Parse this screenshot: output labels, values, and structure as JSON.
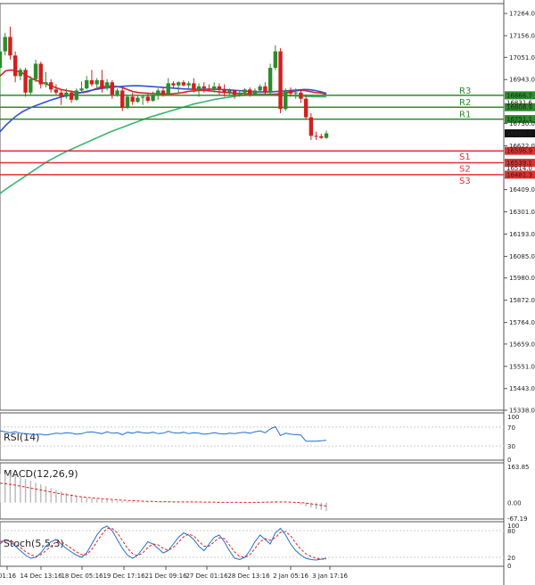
{
  "chart_data": [
    {
      "type": "candlestick",
      "price_axis_ticks": [
        "17264.0",
        "17156.0",
        "17051.0",
        "16943.0",
        "16730.0",
        "16622.0",
        "16409.0",
        "16301.0",
        "16193.0",
        "16085.0",
        "15980.0",
        "15872.0",
        "15764.0",
        "15659.0",
        "15551.0",
        "15443.0",
        "15338.0"
      ],
      "ylim": [
        15338,
        17312
      ],
      "x_tick_labels": [
        "01:16",
        "14 Dec 13:16",
        "18 Dec 05:16",
        "19 Dec 17:16",
        "21 Dec 09:16",
        "27 Dec 01:16",
        "28 Dec 13:16",
        "2 Jan 05:16",
        "3 Jan 17:16"
      ],
      "levels": [
        {
          "name": "R3",
          "value": 16866.7,
          "label": "16866.7",
          "color": "#2e8b2e"
        },
        {
          "name": "R2",
          "value": 16808.9,
          "label": "16808.9",
          "color": "#2e8b2e"
        },
        {
          "name": "R1",
          "value": 16751.1,
          "label": "16751.1",
          "color": "#2e8b2e"
        },
        {
          "name": "S1",
          "value": 16596.9,
          "label": "16596.9",
          "color": "#e03030"
        },
        {
          "name": "S2",
          "value": 16539.1,
          "label": "16539.1",
          "color": "#e03030"
        },
        {
          "name": "S3",
          "value": 16481.3,
          "label": "16481.3",
          "color": "#e03030"
        }
      ],
      "overlap_labels": [
        "16831.6",
        "16514.0"
      ],
      "current_price": {
        "value": 16682.0,
        "label": "16682.0"
      },
      "candles": [
        {
          "o": 17000,
          "h": 17090,
          "l": 16890,
          "c": 17080
        },
        {
          "o": 17080,
          "h": 17170,
          "l": 17060,
          "c": 17150
        },
        {
          "o": 17150,
          "h": 17200,
          "l": 17040,
          "c": 17060
        },
        {
          "o": 17060,
          "h": 17080,
          "l": 16930,
          "c": 16960
        },
        {
          "o": 16960,
          "h": 17000,
          "l": 16940,
          "c": 16990
        },
        {
          "o": 16990,
          "h": 17000,
          "l": 16860,
          "c": 16880
        },
        {
          "o": 16880,
          "h": 16960,
          "l": 16870,
          "c": 16945
        },
        {
          "o": 16945,
          "h": 17040,
          "l": 16930,
          "c": 17020
        },
        {
          "o": 17020,
          "h": 17030,
          "l": 16900,
          "c": 16920
        },
        {
          "o": 16920,
          "h": 16980,
          "l": 16905,
          "c": 16930
        },
        {
          "o": 16930,
          "h": 16945,
          "l": 16880,
          "c": 16895
        },
        {
          "o": 16895,
          "h": 16920,
          "l": 16870,
          "c": 16880
        },
        {
          "o": 16880,
          "h": 16895,
          "l": 16820,
          "c": 16860
        },
        {
          "o": 16860,
          "h": 16900,
          "l": 16850,
          "c": 16880
        },
        {
          "o": 16880,
          "h": 16890,
          "l": 16830,
          "c": 16845
        },
        {
          "o": 16845,
          "h": 16900,
          "l": 16840,
          "c": 16890
        },
        {
          "o": 16890,
          "h": 16935,
          "l": 16880,
          "c": 16900
        },
        {
          "o": 16900,
          "h": 16960,
          "l": 16895,
          "c": 16940
        },
        {
          "o": 16940,
          "h": 16990,
          "l": 16910,
          "c": 16920
        },
        {
          "o": 16920,
          "h": 16950,
          "l": 16905,
          "c": 16940
        },
        {
          "o": 16940,
          "h": 16990,
          "l": 16880,
          "c": 16900
        },
        {
          "o": 16900,
          "h": 16945,
          "l": 16890,
          "c": 16930
        },
        {
          "o": 16930,
          "h": 16940,
          "l": 16850,
          "c": 16870
        },
        {
          "o": 16870,
          "h": 16900,
          "l": 16860,
          "c": 16890
        },
        {
          "o": 16890,
          "h": 16905,
          "l": 16790,
          "c": 16805
        },
        {
          "o": 16805,
          "h": 16870,
          "l": 16800,
          "c": 16860
        },
        {
          "o": 16860,
          "h": 16880,
          "l": 16820,
          "c": 16835
        },
        {
          "o": 16835,
          "h": 16870,
          "l": 16830,
          "c": 16855
        },
        {
          "o": 16855,
          "h": 16870,
          "l": 16820,
          "c": 16860
        },
        {
          "o": 16860,
          "h": 16880,
          "l": 16830,
          "c": 16840
        },
        {
          "o": 16840,
          "h": 16885,
          "l": 16835,
          "c": 16870
        },
        {
          "o": 16870,
          "h": 16900,
          "l": 16845,
          "c": 16890
        },
        {
          "o": 16890,
          "h": 16905,
          "l": 16860,
          "c": 16875
        },
        {
          "o": 16875,
          "h": 16950,
          "l": 16870,
          "c": 16925
        },
        {
          "o": 16925,
          "h": 16935,
          "l": 16900,
          "c": 16915
        },
        {
          "o": 16915,
          "h": 16935,
          "l": 16880,
          "c": 16930
        },
        {
          "o": 16930,
          "h": 16940,
          "l": 16910,
          "c": 16915
        },
        {
          "o": 16915,
          "h": 16935,
          "l": 16900,
          "c": 16925
        },
        {
          "o": 16925,
          "h": 16950,
          "l": 16880,
          "c": 16895
        },
        {
          "o": 16895,
          "h": 16925,
          "l": 16860,
          "c": 16910
        },
        {
          "o": 16910,
          "h": 16930,
          "l": 16880,
          "c": 16900
        },
        {
          "o": 16900,
          "h": 16920,
          "l": 16885,
          "c": 16895
        },
        {
          "o": 16895,
          "h": 16930,
          "l": 16880,
          "c": 16910
        },
        {
          "o": 16910,
          "h": 16925,
          "l": 16870,
          "c": 16895
        },
        {
          "o": 16895,
          "h": 16920,
          "l": 16860,
          "c": 16880
        },
        {
          "o": 16880,
          "h": 16900,
          "l": 16865,
          "c": 16890
        },
        {
          "o": 16890,
          "h": 16895,
          "l": 16850,
          "c": 16870
        },
        {
          "o": 16870,
          "h": 16890,
          "l": 16860,
          "c": 16880
        },
        {
          "o": 16880,
          "h": 16900,
          "l": 16870,
          "c": 16895
        },
        {
          "o": 16895,
          "h": 16905,
          "l": 16860,
          "c": 16875
        },
        {
          "o": 16875,
          "h": 16900,
          "l": 16870,
          "c": 16890
        },
        {
          "o": 16890,
          "h": 16920,
          "l": 16880,
          "c": 16910
        },
        {
          "o": 16910,
          "h": 16930,
          "l": 16870,
          "c": 16880
        },
        {
          "o": 16880,
          "h": 17020,
          "l": 16870,
          "c": 17000
        },
        {
          "o": 17000,
          "h": 17110,
          "l": 16990,
          "c": 17080
        },
        {
          "o": 17080,
          "h": 17095,
          "l": 16780,
          "c": 16800
        },
        {
          "o": 16800,
          "h": 16900,
          "l": 16790,
          "c": 16890
        },
        {
          "o": 16890,
          "h": 16905,
          "l": 16860,
          "c": 16875
        },
        {
          "o": 16875,
          "h": 16900,
          "l": 16850,
          "c": 16880
        },
        {
          "o": 16880,
          "h": 16895,
          "l": 16830,
          "c": 16850
        },
        {
          "o": 16850,
          "h": 16870,
          "l": 16750,
          "c": 16760
        },
        {
          "o": 16760,
          "h": 16780,
          "l": 16650,
          "c": 16670
        },
        {
          "o": 16670,
          "h": 16690,
          "l": 16650,
          "c": 16668
        },
        {
          "o": 16668,
          "h": 16680,
          "l": 16655,
          "c": 16660
        },
        {
          "o": 16660,
          "h": 16695,
          "l": 16655,
          "c": 16682
        }
      ],
      "series": [
        {
          "color": "#e02020",
          "values": [
            16960,
            16985,
            16990,
            16985,
            16975,
            16960,
            16945,
            16935,
            16925,
            16915,
            16905,
            16895,
            16890,
            16885,
            16880,
            16880,
            16885,
            16895,
            16905,
            16910,
            16912,
            16910,
            16905,
            16895,
            16885,
            16880,
            16878,
            16876,
            16875,
            16874,
            16873,
            16874,
            16876,
            16880,
            16885,
            16888,
            16890,
            16890,
            16888,
            16885,
            16882,
            16880,
            16878,
            16876,
            16875,
            16874,
            16873,
            16872,
            16872,
            16872,
            16873,
            16876,
            16880,
            16885,
            16890,
            16890,
            16885,
            16880,
            16878,
            16872
          ]
        },
        {
          "color": "#3050d8",
          "values": [
            16690,
            16720,
            16745,
            16768,
            16786,
            16800,
            16812,
            16822,
            16832,
            16842,
            16850,
            16858,
            16864,
            16870,
            16876,
            16882,
            16888,
            16894,
            16898,
            16902,
            16905,
            16908,
            16910,
            16912,
            16913,
            16913,
            16912,
            16910,
            16908,
            16906,
            16904,
            16902,
            16900,
            16898,
            16897,
            16896,
            16896,
            16896,
            16896,
            16896,
            16895,
            16894,
            16892,
            16890,
            16888,
            16886,
            16884,
            16883,
            16883,
            16884,
            16885,
            16887,
            16889,
            16891,
            16893,
            16895,
            16894,
            16890,
            16884,
            16876
          ]
        },
        {
          "color": "#3cb371",
          "values": [
            16390,
            16410,
            16428,
            16446,
            16464,
            16482,
            16500,
            16518,
            16536,
            16552,
            16566,
            16580,
            16594,
            16606,
            16618,
            16630,
            16642,
            16654,
            16666,
            16678,
            16690,
            16700,
            16710,
            16720,
            16730,
            16740,
            16750,
            16760,
            16768,
            16776,
            16784,
            16792,
            16800,
            16808,
            16816,
            16824,
            16830,
            16836,
            16842,
            16848,
            16852,
            16856,
            16860,
            16864,
            16866,
            16868,
            16869,
            16869,
            16869,
            16868,
            16867,
            16866,
            16865,
            16864,
            16863,
            16862,
            16861,
            16860,
            16860,
            16860
          ]
        }
      ]
    },
    {
      "type": "line",
      "title": "RSI(14)",
      "ylim": [
        0,
        100
      ],
      "axis_ticks": [
        "100",
        "70",
        "30",
        "0"
      ],
      "series": [
        {
          "color": "#1f6fd1",
          "values": [
            62,
            60,
            58,
            60,
            57,
            56,
            55,
            54,
            55,
            53,
            55,
            57,
            56,
            58,
            57,
            55,
            56,
            59,
            60,
            58,
            56,
            60,
            57,
            58,
            54,
            59,
            57,
            60,
            58,
            57,
            59,
            56,
            57,
            61,
            58,
            57,
            59,
            56,
            58,
            57,
            55,
            56,
            58,
            56,
            55,
            57,
            56,
            58,
            59,
            57,
            60,
            62,
            58,
            66,
            71,
            52,
            57,
            55,
            54,
            53,
            40,
            40,
            40,
            41,
            42
          ]
        }
      ]
    },
    {
      "type": "bar",
      "title": "MACD(12,26,9)",
      "ylim": [
        -67.19,
        163.85
      ],
      "axis_ticks": [
        "163.85",
        "0.00",
        "-67.19"
      ],
      "series": [
        {
          "color": "#b8b8b8",
          "values": [
            120,
            118,
            115,
            110,
            105,
            98,
            90,
            82,
            75,
            68,
            60,
            52,
            46,
            40,
            34,
            28,
            24,
            20,
            17,
            15,
            13,
            12,
            10,
            8,
            7,
            5,
            4,
            3,
            2,
            2,
            1,
            1,
            2,
            3,
            3,
            3,
            3,
            2,
            2,
            2,
            1,
            1,
            0,
            0,
            -1,
            -1,
            0,
            0,
            1,
            1,
            2,
            3,
            3,
            5,
            6,
            4,
            2,
            0,
            -3,
            -8,
            -15,
            -20,
            -26,
            -30,
            -34
          ]
        },
        {
          "color": "#e02020",
          "values": [
            80,
            78,
            75,
            72,
            68,
            64,
            60,
            56,
            52,
            48,
            44,
            40,
            36,
            33,
            30,
            27,
            24,
            22,
            20,
            18,
            16,
            15,
            13,
            12,
            10,
            9,
            8,
            7,
            6,
            5,
            5,
            4,
            4,
            4,
            3,
            3,
            3,
            3,
            3,
            3,
            2,
            2,
            2,
            1,
            1,
            1,
            1,
            1,
            1,
            1,
            1,
            1,
            2,
            2,
            3,
            3,
            3,
            2,
            1,
            0,
            -2,
            -5,
            -8,
            -11,
            -14
          ]
        }
      ]
    },
    {
      "type": "line",
      "title": "Stoch(5,5,3)",
      "ylim": [
        0,
        100
      ],
      "axis_ticks": [
        "100",
        "80",
        "20",
        "0"
      ],
      "series": [
        {
          "color": "#1f6fd1",
          "values": [
            50,
            60,
            55,
            45,
            35,
            25,
            18,
            20,
            30,
            45,
            55,
            60,
            50,
            40,
            32,
            25,
            20,
            30,
            50,
            70,
            85,
            90,
            80,
            60,
            40,
            25,
            18,
            25,
            40,
            55,
            50,
            40,
            30,
            35,
            50,
            65,
            75,
            70,
            60,
            45,
            35,
            50,
            65,
            70,
            55,
            35,
            18,
            15,
            20,
            35,
            55,
            70,
            60,
            50,
            75,
            85,
            70,
            50,
            35,
            25,
            18,
            15,
            14,
            16,
            18
          ]
        },
        {
          "color": "#e02020",
          "values": [
            55,
            58,
            56,
            50,
            42,
            33,
            26,
            22,
            26,
            35,
            45,
            55,
            55,
            48,
            40,
            32,
            26,
            26,
            38,
            55,
            72,
            85,
            85,
            75,
            58,
            40,
            28,
            24,
            30,
            42,
            50,
            48,
            40,
            36,
            42,
            54,
            66,
            72,
            68,
            56,
            45,
            45,
            55,
            64,
            62,
            48,
            32,
            22,
            20,
            26,
            40,
            55,
            62,
            58,
            64,
            76,
            78,
            68,
            52,
            38,
            28,
            22,
            18,
            16,
            16
          ]
        }
      ]
    }
  ]
}
